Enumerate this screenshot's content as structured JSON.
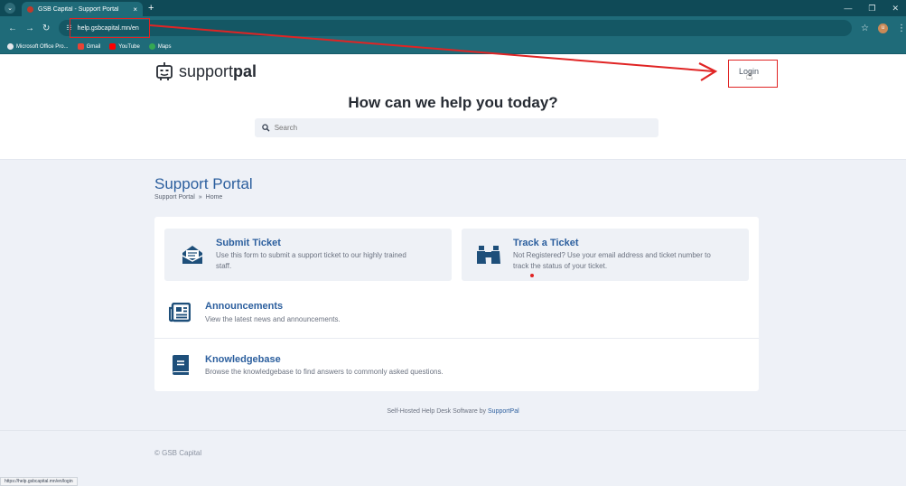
{
  "browser": {
    "tab_title": "GSB Capital - Support Portal",
    "tab_close": "×",
    "new_tab": "+",
    "url": "help.gsbcapital.mn/en",
    "status_url": "https://help.gsbcapital.mn/en/login",
    "profile_initial": "u",
    "bookmarks": [
      {
        "label": "Microsoft Office Pro...",
        "color": "#e5e7eb"
      },
      {
        "label": "Gmail",
        "color": "#ea4335"
      },
      {
        "label": "YouTube",
        "color": "#ff0000"
      },
      {
        "label": "Maps",
        "color": "#34a853"
      }
    ]
  },
  "header": {
    "brand_light": "support",
    "brand_bold": "pal",
    "login_label": "Login",
    "hero_title": "How can we help you today?",
    "search_placeholder": "Search"
  },
  "portal": {
    "title": "Support Portal",
    "breadcrumb": [
      "Support Portal",
      "»",
      "Home"
    ]
  },
  "tiles": {
    "submit": {
      "title": "Submit Ticket",
      "desc_line1": "Use this form to submit a support ticket to our highly trained",
      "desc_line2": "staff."
    },
    "track": {
      "title": "Track a Ticket",
      "desc_line1": "Not Registered? Use your email address and ticket number to",
      "desc_line2": "track the status of your ticket."
    },
    "announcements": {
      "title": "Announcements",
      "desc": "View the latest news and announcements."
    },
    "knowledgebase": {
      "title": "Knowledgebase",
      "desc": "Browse the knowledgebase to find answers to commonly asked questions."
    }
  },
  "footer": {
    "credit_prefix": "Self-Hosted Help Desk Software by",
    "credit_link": "SupportPal",
    "copyright": "© GSB Capital"
  },
  "colors": {
    "accent": "#2c5f9e",
    "chrome": "#1f6b79",
    "annotation": "#e02424"
  }
}
